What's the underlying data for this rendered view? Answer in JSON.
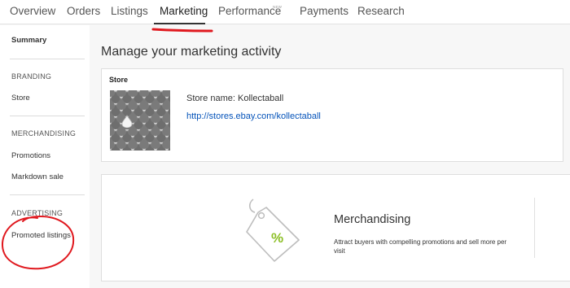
{
  "top_nav": {
    "tabs": [
      {
        "label": "Overview"
      },
      {
        "label": "Orders"
      },
      {
        "label": "Listings"
      },
      {
        "label": "Marketing"
      },
      {
        "label": "Performance"
      },
      {
        "label": "Payments"
      },
      {
        "label": "Research"
      }
    ],
    "active_tab": "Marketing",
    "new_badge": "NEW"
  },
  "sidebar": {
    "summary": "Summary",
    "branding_heading": "BRANDING",
    "store": "Store",
    "merchandising_heading": "MERCHANDISING",
    "promotions": "Promotions",
    "markdown_sale": "Markdown sale",
    "advertising_heading": "ADVERTISING",
    "promoted_listings": "Promoted listings"
  },
  "main": {
    "title": "Manage your marketing activity",
    "store_card": {
      "heading": "Store",
      "name_label": "Store name:",
      "name_value": "Kollectaball",
      "url": "http://stores.ebay.com/kollectaball"
    },
    "merch_card": {
      "title": "Merchandising",
      "description": "Attract buyers with compelling promotions and sell more per visit",
      "icon_text": "%"
    }
  },
  "colors": {
    "link": "#0654ba",
    "annotation_red": "#e0191f",
    "tag_green": "#8cbf26"
  }
}
